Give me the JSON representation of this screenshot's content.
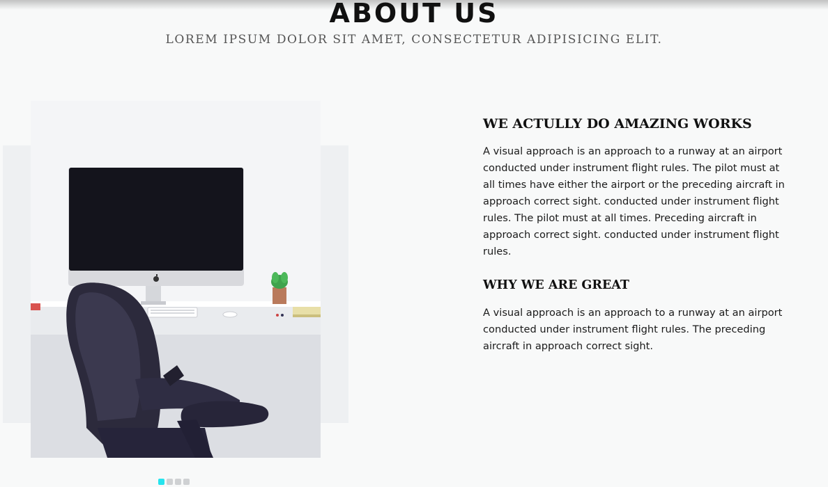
{
  "header": {
    "title": "ABOUT US",
    "subtitle": "LOREM IPSUM DOLOR SIT AMET, CONSECTETUR ADIPISICING ELIT."
  },
  "about": {
    "heading_1": "WE ACTULLY DO AMAZING WORKS",
    "paragraph_1": "A visual approach is an approach to a runway at an airport conducted under instrument flight rules. The pilot must at all times have either the airport or the preceding aircraft in approach correct sight. conducted under instrument flight rules. The pilot must at all times. Preceding aircraft in approach correct sight. conducted under instrument flight rules.",
    "heading_2": "WHY WE ARE GREAT",
    "paragraph_2": "A visual approach is an approach to a runway at an airport conducted under instrument flight rules. The preceding aircraft in approach correct sight."
  },
  "carousel": {
    "slide_count": 4,
    "active_index": 0
  },
  "colors": {
    "accent": "#26e4ee",
    "background": "#f8f9f9",
    "panel": "#eef0f2"
  },
  "icons": [
    "apple-logo-icon"
  ]
}
